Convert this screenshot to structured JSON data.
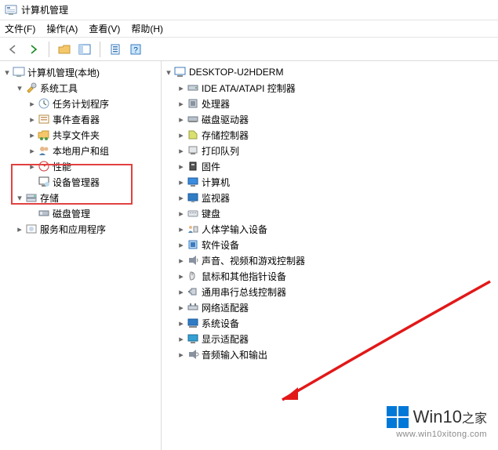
{
  "title": "计算机管理",
  "menu": {
    "file": "文件(F)",
    "action": "操作(A)",
    "view": "查看(V)",
    "help": "帮助(H)"
  },
  "left_tree": {
    "root": "计算机管理(本地)",
    "system_tools": {
      "label": "系统工具",
      "task_scheduler": "任务计划程序",
      "event_viewer": "事件查看器",
      "shared_folders": "共享文件夹",
      "local_users": "本地用户和组",
      "performance": "性能",
      "device_manager": "设备管理器"
    },
    "storage": {
      "label": "存储",
      "disk_mgmt": "磁盘管理"
    },
    "services_apps": "服务和应用程序"
  },
  "right_tree": {
    "root": "DESKTOP-U2HDERM",
    "items": [
      "IDE ATA/ATAPI 控制器",
      "处理器",
      "磁盘驱动器",
      "存储控制器",
      "打印队列",
      "固件",
      "计算机",
      "监视器",
      "键盘",
      "人体学输入设备",
      "软件设备",
      "声音、视频和游戏控制器",
      "鼠标和其他指针设备",
      "通用串行总线控制器",
      "网络适配器",
      "系统设备",
      "显示适配器",
      "音频输入和输出"
    ]
  },
  "watermark": {
    "brand": "Win10",
    "suffix": "之家",
    "url": "www.win10xitong.com"
  }
}
